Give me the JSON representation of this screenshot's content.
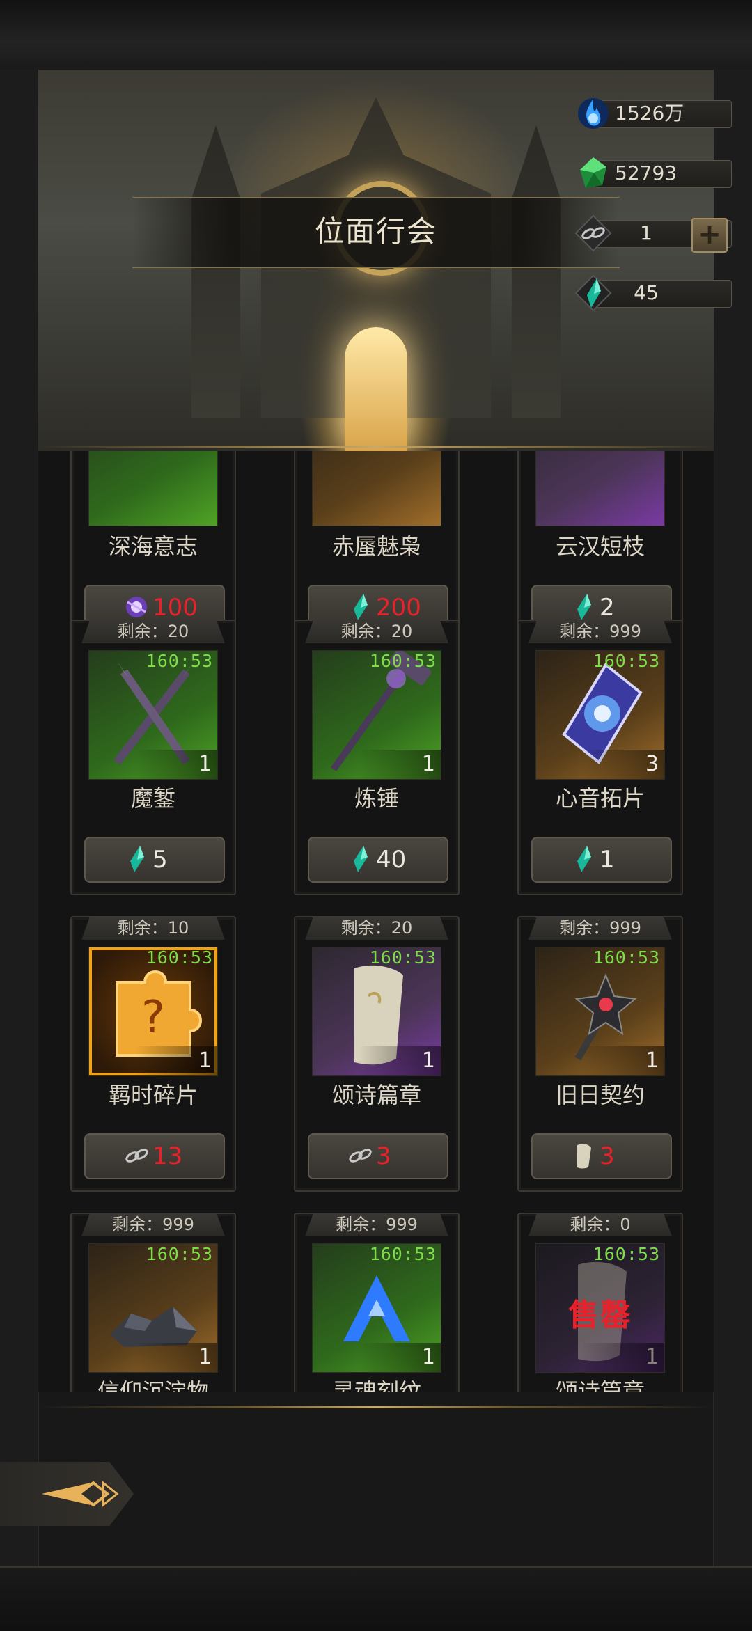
{
  "header": {
    "title": "位面行会",
    "resources": [
      {
        "icon": "blue-flame-icon",
        "value": "1526万"
      },
      {
        "icon": "green-gem-icon",
        "value": "52793"
      },
      {
        "icon": "chain-link-icon",
        "value": "1"
      },
      {
        "icon": "teal-crystal-icon",
        "value": "45"
      }
    ]
  },
  "shop": {
    "remain_prefix": "剩余：",
    "sold_out_label": "售罄",
    "items": [
      {
        "name": "深海意志",
        "price": "100",
        "price_color": "red",
        "currency_icon": "purple-orb-icon",
        "partial": true
      },
      {
        "name": "赤蜃魅枭",
        "price": "200",
        "price_color": "red",
        "currency_icon": "teal-crystal-icon",
        "partial": true
      },
      {
        "name": "云汉短枝",
        "price": "2",
        "price_color": "white",
        "currency_icon": "teal-crystal-icon",
        "partial": true
      },
      {
        "name": "魔錾",
        "remain": "剩余：20",
        "timer": "160:53",
        "qty": "1",
        "price": "5",
        "price_color": "white",
        "currency_icon": "teal-crystal-icon",
        "icon": "crossed-spears-icon"
      },
      {
        "name": "炼锤",
        "remain": "剩余：20",
        "timer": "160:53",
        "qty": "1",
        "price": "40",
        "price_color": "white",
        "currency_icon": "teal-crystal-icon",
        "icon": "hammer-staff-icon"
      },
      {
        "name": "心音拓片",
        "remain": "剩余：999",
        "timer": "160:53",
        "qty": "3",
        "price": "1",
        "price_color": "white",
        "currency_icon": "teal-crystal-icon",
        "icon": "rune-tablet-icon"
      },
      {
        "name": "羁时碎片",
        "remain": "剩余：10",
        "timer": "160:53",
        "qty": "1",
        "price": "13",
        "price_color": "red",
        "currency_icon": "chain-link-icon",
        "icon": "puzzle-piece-icon"
      },
      {
        "name": "颂诗篇章",
        "remain": "剩余：20",
        "timer": "160:53",
        "qty": "1",
        "price": "3",
        "price_color": "red",
        "currency_icon": "chain-link-icon",
        "icon": "scroll-page-icon"
      },
      {
        "name": "旧日契约",
        "remain": "剩余：999",
        "timer": "160:53",
        "qty": "1",
        "price": "3",
        "price_color": "red",
        "currency_icon": "scroll-page-icon",
        "icon": "dark-star-mace-icon"
      },
      {
        "name": "信仰沉淀物",
        "remain": "剩余：999",
        "timer": "160:53",
        "qty": "1",
        "icon": "ore-pile-icon"
      },
      {
        "name": "灵魂刻纹",
        "remain": "剩余：999",
        "timer": "160:53",
        "qty": "1",
        "icon": "blue-rune-mark-icon"
      },
      {
        "name": "颂诗篇章",
        "remain": "剩余：0",
        "timer": "160:53",
        "qty": "1",
        "icon": "scroll-page-icon",
        "sold_out": true
      }
    ]
  },
  "footer": {
    "back_icon": "back-arrow-icon"
  },
  "colors": {
    "accent_gold": "#c9a96a",
    "price_red": "#e8212b",
    "timer_green": "#7fdc4a"
  }
}
